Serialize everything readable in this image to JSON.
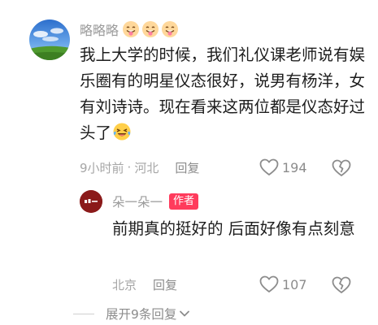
{
  "comment": {
    "username": "略略略",
    "username_emojis": [
      "tongue-face-emoji",
      "tongue-face-emoji",
      "tongue-face-emoji"
    ],
    "text": "我上大学的时候，我们礼仪课老师说有娱乐圈有的明星仪态很好，说男有杨洋，女有刘诗诗。现在看来这两位都是仪态好过头了",
    "text_emoji": "laughing-tears-emoji",
    "time": "9小时前",
    "separator": "·",
    "location": "河北",
    "reply_label": "回复",
    "like_count": "194"
  },
  "reply": {
    "username": "朵一朵一",
    "author_badge": "作者",
    "text": "前期真的挺好的 后面好像有点刻意",
    "location": "北京",
    "reply_label": "回复",
    "like_count": "107"
  },
  "expand": {
    "label": "展开9条回复"
  },
  "colors": {
    "badge": "#ff3b5c",
    "muted_text": "#9b9b9b",
    "body_text": "#1d1d1d"
  }
}
